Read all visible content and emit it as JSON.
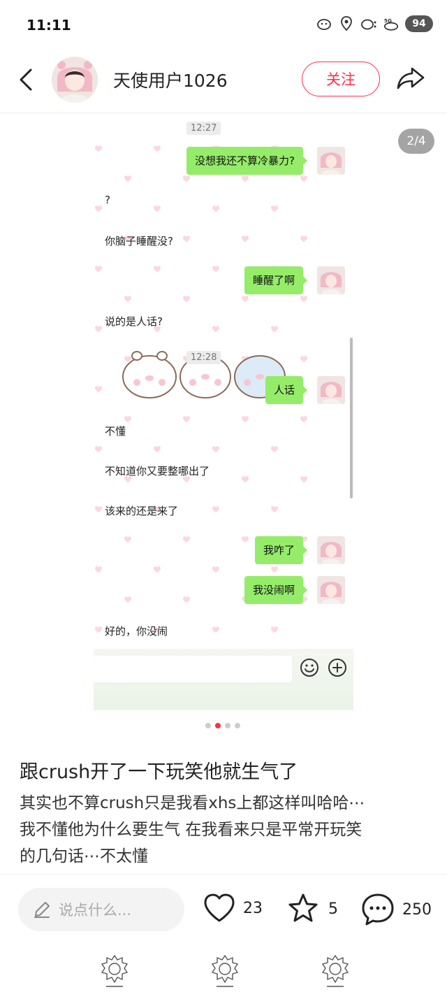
{
  "status_bar": {
    "time": "11:11",
    "battery": "94",
    "network": "5G"
  },
  "header": {
    "user_name": "天使用户1026",
    "follow_label": "关注"
  },
  "image": {
    "page_counter": "2/4",
    "chat": {
      "time_1": "12:27",
      "time_2": "12:28",
      "messages": [
        {
          "side": "right",
          "text": "没想我还不算冷暴力?"
        },
        {
          "side": "left",
          "text": "?"
        },
        {
          "side": "left",
          "text": "你脑子睡醒没?"
        },
        {
          "side": "right",
          "text": "睡醒了啊"
        },
        {
          "side": "left",
          "text": "说的是人话?"
        },
        {
          "side": "right",
          "text": "人话"
        },
        {
          "side": "left",
          "text": "不懂"
        },
        {
          "side": "left",
          "text": "不知道你又要整哪出了"
        },
        {
          "side": "left",
          "text": "该来的还是来了"
        },
        {
          "side": "right",
          "text": "我咋了"
        },
        {
          "side": "right",
          "text": "我没闹啊"
        },
        {
          "side": "left",
          "text": "好的，你没闹"
        }
      ]
    }
  },
  "carousel": {
    "count": 4,
    "active": 2
  },
  "post": {
    "title": "跟crush开了一下玩笑他就生气了",
    "body_lines": [
      "其实也不算crush只是我看xhs上都这样叫哈哈⋯",
      "我不懂他为什么要生气 在我看来只是平常开玩笑",
      "的几句话⋯不太懂"
    ]
  },
  "bottom_bar": {
    "comment_placeholder": "说点什么...",
    "likes": "23",
    "favorites": "5",
    "comments": "250"
  },
  "icons": {
    "back": "back-arrow-icon",
    "share": "share-arrow-icon",
    "like": "heart-icon",
    "favorite": "star-icon",
    "comment": "comment-bubble-icon",
    "pen": "pen-icon"
  },
  "colors": {
    "accent": "#ff2e4d",
    "wechat_green": "#95ec69"
  }
}
